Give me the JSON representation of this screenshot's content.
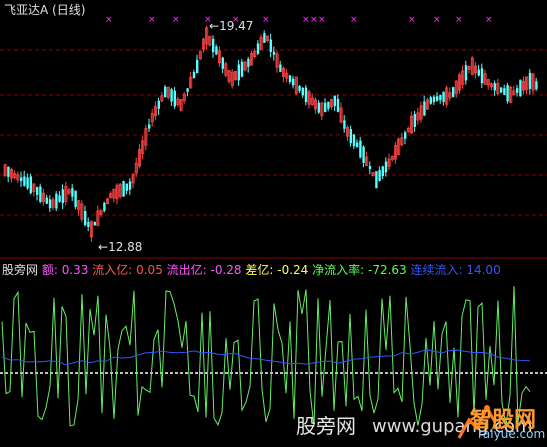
{
  "header": {
    "stock_title": "飞亚达A",
    "period": "(日线)"
  },
  "price_labels": {
    "high": "19.47",
    "low": "12.88",
    "high_arrow": "←",
    "low_arrow": "←"
  },
  "indicator": {
    "name": "股旁网",
    "items": [
      {
        "label": "额:",
        "value": "0.33",
        "color": "#ff55ff"
      },
      {
        "label": "流入亿:",
        "value": "0.05",
        "color": "#ff5555"
      },
      {
        "label": "流出亿:",
        "value": "-0.28",
        "color": "#ff55ff"
      },
      {
        "label": "差亿:",
        "value": "-0.24",
        "color": "#ffff55"
      },
      {
        "label": "净流入率:",
        "value": "-72.63",
        "color": "#55ff55"
      },
      {
        "label": "连续流入:",
        "value": "14.00",
        "color": "#3355ff"
      }
    ]
  },
  "watermark": {
    "site_cn": "股旁网",
    "site_url": "www.gupang.com",
    "logo_cn": "智股网",
    "logo_url": "raiyue.com"
  },
  "colors": {
    "up_candle": "#ff4444",
    "down_candle": "#55ffff",
    "grid": "#8b0000",
    "marker": "#ff33ff",
    "osc_line": "#66ee66",
    "ma_line": "#3355ff",
    "baseline": "#ffffff"
  }
}
